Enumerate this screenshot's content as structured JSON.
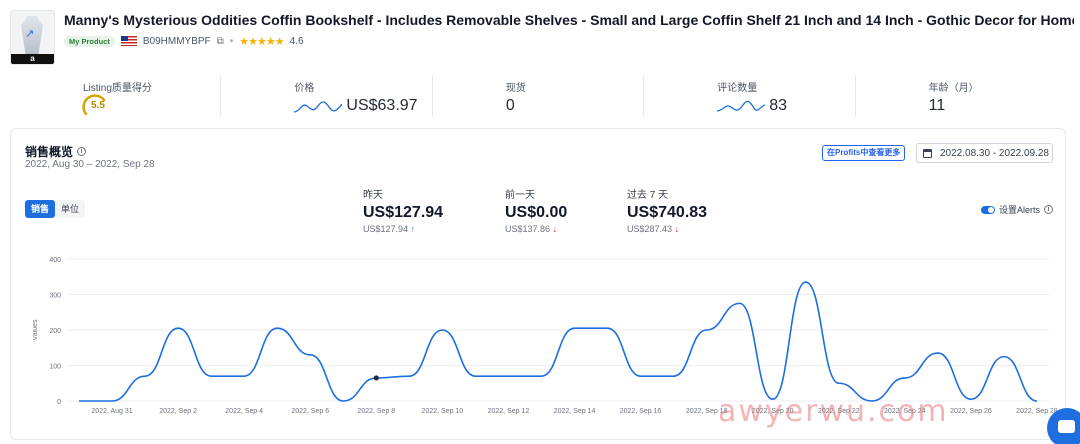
{
  "product": {
    "title": "Manny's Mysterious Oddities Coffin Bookshelf - Includes Removable Shelves - Small and Large Coffin Shelf 21 Inch and 14 Inch - Gothic Decor for Home",
    "badge": "My Product",
    "asin": "B09HMMYBPF",
    "rating": "4.6",
    "stars_value": 4.5,
    "icons": {
      "thumbnail": "product-thumbnail",
      "external_link": "external-link-icon",
      "flag": "us-flag-icon",
      "copy": "copy-icon",
      "star": "star-icon"
    },
    "thumb_bar": "a"
  },
  "stats": [
    {
      "label": "Listing质量得分",
      "value": "5.5",
      "kind": "score"
    },
    {
      "label": "价格",
      "value": "US$63.97",
      "kind": "spark"
    },
    {
      "label": "现货",
      "value": "0",
      "kind": "plain"
    },
    {
      "label": "评论数量",
      "value": "83",
      "kind": "spark"
    },
    {
      "label": "年龄（月）",
      "value": "11",
      "kind": "plain"
    }
  ],
  "sales": {
    "title": "销售概览",
    "range": "2022, Aug 30 – 2022, Sep 28",
    "profits_button": "在Profits中查看更多",
    "date_button": "2022.08.30 - 2022.09.28",
    "segments": [
      "销售",
      "单位"
    ],
    "active_segment": 0,
    "kpis": [
      {
        "label": "昨天",
        "value": "US$127.94",
        "sub": "US$127.94",
        "trend": "up"
      },
      {
        "label": "前一天",
        "value": "US$0.00",
        "sub": "US$137.86",
        "trend": "down"
      },
      {
        "label": "过去 7 天",
        "value": "US$740.83",
        "sub": "US$287.43",
        "trend": "down"
      }
    ],
    "alerts_label": "设置Alerts",
    "alerts_on": true
  },
  "colors": {
    "accent": "#1d6fe0",
    "up": "#16a34a",
    "down": "#dc2626",
    "score": "#d4a400"
  },
  "chart_data": {
    "type": "line",
    "ylabel": "Values",
    "ylim": [
      0,
      400
    ],
    "yticks": [
      0,
      100,
      200,
      300,
      400
    ],
    "x": [
      "2022-08-30",
      "2022-08-31",
      "2022-09-01",
      "2022-09-02",
      "2022-09-03",
      "2022-09-04",
      "2022-09-05",
      "2022-09-06",
      "2022-09-07",
      "2022-09-08",
      "2022-09-09",
      "2022-09-10",
      "2022-09-11",
      "2022-09-12",
      "2022-09-13",
      "2022-09-14",
      "2022-09-15",
      "2022-09-16",
      "2022-09-17",
      "2022-09-18",
      "2022-09-19",
      "2022-09-20",
      "2022-09-21",
      "2022-09-22",
      "2022-09-23",
      "2022-09-24",
      "2022-09-25",
      "2022-09-26",
      "2022-09-27",
      "2022-09-28"
    ],
    "values": [
      0,
      0,
      70,
      205,
      70,
      70,
      205,
      130,
      0,
      65,
      70,
      200,
      70,
      70,
      70,
      205,
      205,
      70,
      70,
      200,
      275,
      5,
      335,
      50,
      0,
      65,
      135,
      5,
      125,
      0
    ],
    "xtick_labels": [
      "2022, Aug 31",
      "2022, Sep 2",
      "2022, Sep 4",
      "2022, Sep 6",
      "2022, Sep 8",
      "2022, Sep 10",
      "2022, Sep 12",
      "2022, Sep 14",
      "2022, Sep 16",
      "2022, Sep 18",
      "2022, Sep 20",
      "2022, Sep 22",
      "2022, Sep 24",
      "2022, Sep 26",
      "2022, Sep 28"
    ],
    "highlight_index": 9,
    "grid": true
  },
  "watermark": "awyerwu.com"
}
